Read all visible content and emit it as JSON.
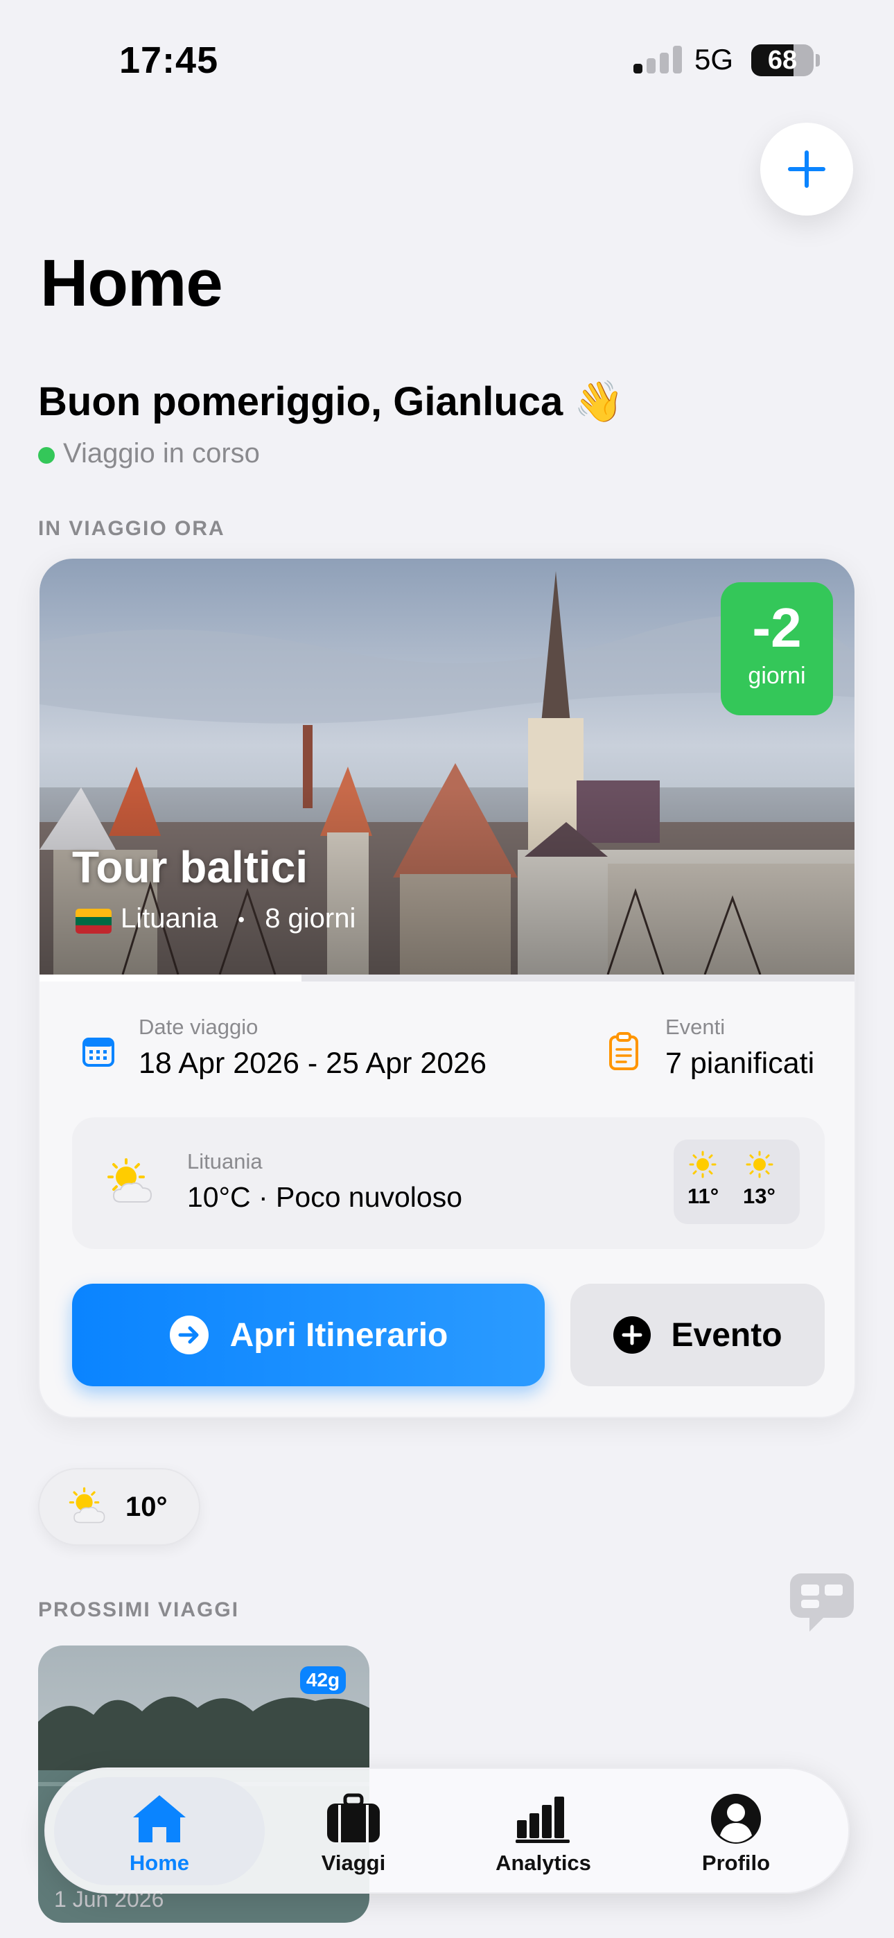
{
  "status_bar": {
    "time": "17:45",
    "network": "5G",
    "battery": "68"
  },
  "page": {
    "title": "Home"
  },
  "greeting": {
    "text": "Buon pomeriggio, Gianluca 👋",
    "status": "Viaggio in corso",
    "status_color": "#34c759"
  },
  "current_section": {
    "label": "IN VIAGGIO ORA"
  },
  "current_trip": {
    "title": "Tour baltici",
    "country": "Lituania",
    "duration": "8 giorni",
    "separator": "•",
    "countdown_value": "-2",
    "countdown_unit": "giorni",
    "progress_fraction": 0.32,
    "dates_label": "Date viaggio",
    "dates_value": "18 Apr 2026 - 25 Apr 2026",
    "events_label": "Eventi",
    "events_value": "7 pianificati",
    "weather": {
      "location": "Lituania",
      "current": "10°C · Poco nuvoloso",
      "forecast": [
        {
          "icon": "sun-icon",
          "temp": "11°"
        },
        {
          "icon": "sun-icon",
          "temp": "13°"
        }
      ]
    },
    "primary_button": "Apri Itinerario",
    "secondary_button": "Evento"
  },
  "weather_chip": {
    "icon": "partly-cloudy-icon",
    "temp": "10°"
  },
  "upcoming_section": {
    "label": "PROSSIMI VIAGGI"
  },
  "upcoming_trips": [
    {
      "badge": "42g",
      "date": "1 Jun 2026"
    }
  ],
  "tabbar": {
    "active": "Home",
    "items": [
      {
        "label": "Home",
        "icon": "house-icon"
      },
      {
        "label": "Viaggi",
        "icon": "suitcase-icon"
      },
      {
        "label": "Analytics",
        "icon": "bar-chart-icon"
      },
      {
        "label": "Profilo",
        "icon": "person-icon"
      }
    ]
  },
  "colors": {
    "accent": "#0a84ff",
    "success": "#34c759",
    "events_orange": "#ff9500"
  }
}
